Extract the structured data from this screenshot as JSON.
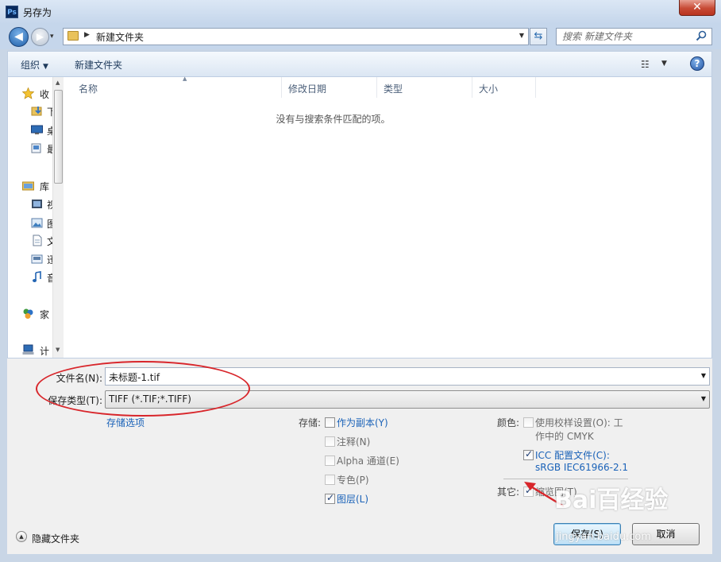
{
  "window": {
    "title": "另存为",
    "app_icon": "Ps",
    "close_glyph": "✕"
  },
  "address": {
    "path": "新建文件夹",
    "search_placeholder": "搜索 新建文件夹"
  },
  "toolbar": {
    "organize": "组织",
    "new_folder": "新建文件夹"
  },
  "nav": {
    "groups": [
      {
        "label": "收",
        "icon": "star-icon",
        "items": [
          {
            "label": "下",
            "icon": "downloads-icon"
          },
          {
            "label": "桌",
            "icon": "desktop-icon"
          },
          {
            "label": "最",
            "icon": "recent-icon"
          }
        ]
      },
      {
        "label": "库",
        "icon": "library-icon",
        "items": [
          {
            "label": "视",
            "icon": "video-icon"
          },
          {
            "label": "图",
            "icon": "picture-icon"
          },
          {
            "label": "文",
            "icon": "document-icon"
          },
          {
            "label": "迅",
            "icon": "thunder-icon"
          },
          {
            "label": "音",
            "icon": "music-icon"
          }
        ]
      },
      {
        "label": "家",
        "icon": "homegroup-icon",
        "items": []
      },
      {
        "label": "计",
        "icon": "computer-icon",
        "items": []
      }
    ]
  },
  "list": {
    "columns": [
      {
        "label": "名称"
      },
      {
        "label": "修改日期"
      },
      {
        "label": "类型"
      },
      {
        "label": "大小"
      }
    ],
    "empty_message": "没有与搜索条件匹配的项。"
  },
  "form": {
    "filename_label": "文件名(N):",
    "filename_value": "未标题-1.tif",
    "filetype_label": "保存类型(T):",
    "filetype_value": "TIFF (*.TIF;*.TIFF)",
    "save_options_link": "存储选项"
  },
  "save_opts": {
    "label": "存储:",
    "items": [
      {
        "label": "作为副本(Y)",
        "checked": false,
        "enabled": true
      },
      {
        "label": "注释(N)",
        "checked": false,
        "enabled": false
      },
      {
        "label": "Alpha 通道(E)",
        "checked": false,
        "enabled": false
      },
      {
        "label": "专色(P)",
        "checked": false,
        "enabled": false
      },
      {
        "label": "图层(L)",
        "checked": true,
        "enabled": true
      }
    ]
  },
  "color_opts": {
    "label": "颜色:",
    "proof": {
      "line1": "使用校样设置(O):  工",
      "line2": "作中的 CMYK",
      "checked": false
    },
    "icc": {
      "line1": "ICC 配置文件(C):",
      "line2": "sRGB IEC61966-2.1",
      "checked": true
    }
  },
  "other_opts": {
    "label": "其它:",
    "thumbnail": {
      "label": "缩览图(T)",
      "checked": true
    }
  },
  "footer": {
    "hide_folders": "隐藏文件夹",
    "save": "保存(S)",
    "cancel": "取消"
  },
  "watermark": {
    "brand": "Bai百经验",
    "url": "jingyan.baidu.com"
  },
  "colors": {
    "accent_red": "#d8262b",
    "link_blue": "#1a62b8"
  }
}
